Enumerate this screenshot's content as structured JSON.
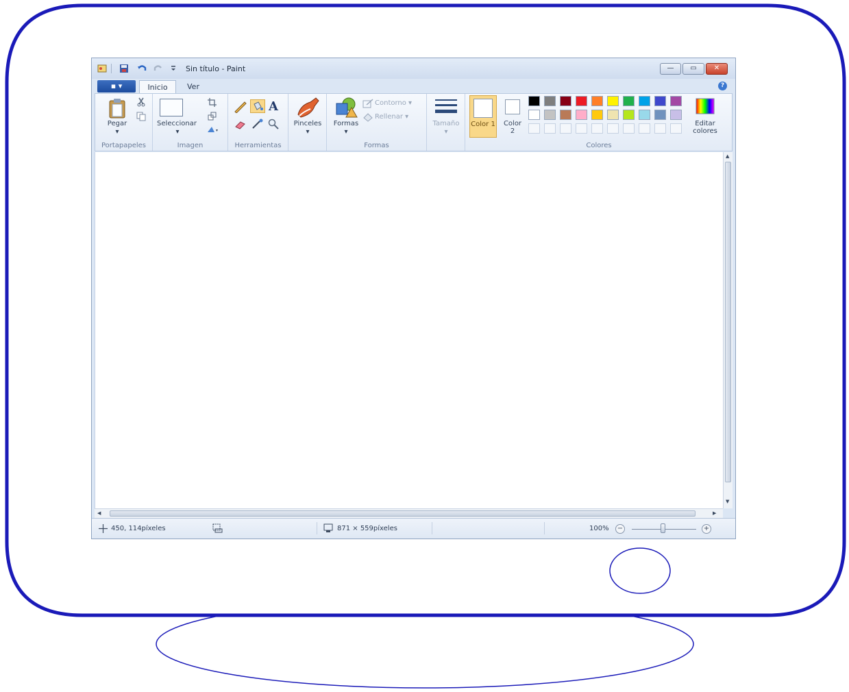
{
  "window": {
    "title": "Sin título - Paint",
    "controls": {
      "minimize": "—",
      "maximize": "▭",
      "close": "✕"
    }
  },
  "tabs": {
    "file": "▪ ▾",
    "items": [
      "Inicio",
      "Ver"
    ],
    "help": "?"
  },
  "ribbon": {
    "portapapeles": {
      "paste": "Pegar",
      "label": "Portapapeles"
    },
    "imagen": {
      "select": "Seleccionar",
      "label": "Imagen"
    },
    "herramientas": {
      "label": "Herramientas",
      "text_tool": "A"
    },
    "pinceles": {
      "label": "Pinceles"
    },
    "formas": {
      "shapes": "Formas",
      "outline": "Contorno",
      "fill": "Rellenar",
      "label": "Formas"
    },
    "tamano": {
      "label": "Tamaño"
    },
    "colores": {
      "color1": "Color 1",
      "color2": "Color 2",
      "edit": "Editar colores",
      "label": "Colores",
      "palette_row1": [
        "#000000",
        "#7f7f7f",
        "#880015",
        "#ed1c24",
        "#ff7f27",
        "#fff200",
        "#22b14c",
        "#00a2e8",
        "#3f48cc",
        "#a349a4"
      ],
      "palette_row2": [
        "#ffffff",
        "#c3c3c3",
        "#b97a57",
        "#ffaec9",
        "#ffc90e",
        "#efe4b0",
        "#b5e61d",
        "#99d9ea",
        "#7092be",
        "#c8bfe7"
      ]
    }
  },
  "status": {
    "cursor_pos": "450, 114píxeles",
    "canvas_size": "871 × 559píxeles",
    "zoom": "100%"
  },
  "colors": {
    "frame": "#1a1ab8",
    "accent_selected": "#f9d889"
  }
}
